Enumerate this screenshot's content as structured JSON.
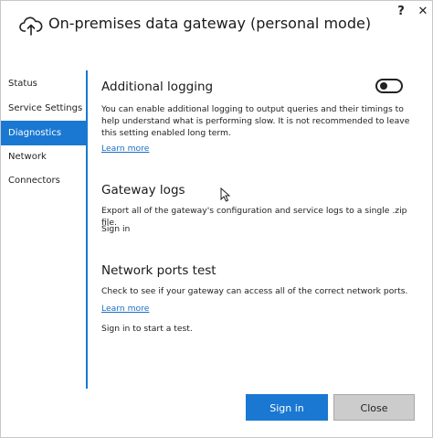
{
  "window": {
    "title": "On-premises data gateway (personal mode)",
    "help_label": "?",
    "close_label": "✕"
  },
  "sidebar": {
    "items": [
      {
        "label": "Status"
      },
      {
        "label": "Service Settings"
      },
      {
        "label": "Diagnostics",
        "active": true
      },
      {
        "label": "Network"
      },
      {
        "label": "Connectors"
      }
    ]
  },
  "diagnostics": {
    "logging": {
      "title": "Additional logging",
      "description": "You can enable additional logging to output queries and their timings to help understand what is performing slow. It is not recommended to leave this setting enabled long term.",
      "learn_more": "Learn more",
      "toggle_on": false
    },
    "gateway_logs": {
      "title": "Gateway logs",
      "description": "Export all of the gateway's configuration and service logs to a single .zip file.",
      "action": "Sign in"
    },
    "ports_test": {
      "title": "Network ports test",
      "description": "Check to see if your gateway can access all of the correct network ports.",
      "learn_more": "Learn more",
      "status": "Sign in to start a test."
    }
  },
  "footer": {
    "primary_label": "Sign in",
    "secondary_label": "Close"
  },
  "colors": {
    "accent": "#1a78d2",
    "link": "#1a6fc4",
    "secondary_button": "#cccccc"
  }
}
